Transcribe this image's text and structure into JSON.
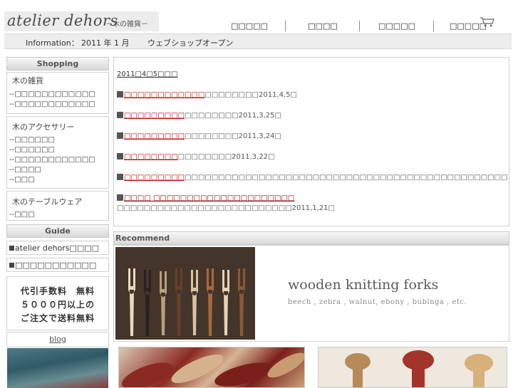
{
  "header": {
    "logo": "atelier dehors",
    "logo_sub": "－木の雑貨－",
    "nav": [
      "□□□□□",
      "□□□□",
      "□□□□□",
      "□□□□□"
    ]
  },
  "info": {
    "label": "Information：",
    "date": "2011 年 1 月",
    "message": "ウェブショップオープン"
  },
  "sidebar": {
    "shopping_heading": "Shopping",
    "boxes": [
      {
        "title": "木の雑貨",
        "links": [
          "--□□□□□□□□□□□□",
          "--□□□□□□□□□□□□"
        ]
      },
      {
        "title": "木のアクセサリー",
        "links": [
          "--□□□□□□",
          "--□□□□□□",
          "--□□□□□□□□□□□□",
          "--□□□□",
          "--□□□"
        ]
      },
      {
        "title": "木のテーブルウェア",
        "links": [
          "--□□□"
        ]
      }
    ],
    "guide_heading": "Guide",
    "guide_links": [
      "atelier dehors□□□□",
      "□□□□□□□□□□□"
    ],
    "fee_lines": [
      "代引手数料　無料",
      "５０００円以上の",
      "ご注文で送料無料"
    ],
    "blog": "blog"
  },
  "news": {
    "date_link": "2011□4□5□□□",
    "items": [
      {
        "link": "□□□□□□□□□□□□",
        "text": "□□□□□□□□2011,4,5□",
        "line2": ""
      },
      {
        "link": "□□□□□□□□□",
        "text": "□□□□□□□□2011,3,25□",
        "line2": ""
      },
      {
        "link": "□□□□□□□□□",
        "text": "□□□□□□□□2011,3,24□",
        "line2": ""
      },
      {
        "link": "□□□□□□□□",
        "text": "□□□□□□□□2011,3,22□",
        "line2": ""
      },
      {
        "link": "□□□□□□□□□",
        "text": "□□□□□□□□□□□□□□□□□□□□□□□□□□□□□□□□□□□□□□□□□□□□□□□□□□□□□□□□□□□□□□□□□□□□□□□",
        "line2": ""
      },
      {
        "link": "□□□□ □□□□□□□□□□□□□□□□□□□□□",
        "text": "",
        "line2": "□□□□□□□□□□□□□□□□□□□□□□□□□□2011,1,21□"
      }
    ]
  },
  "recommend": {
    "heading": "Recommend",
    "title": "wooden knitting forks",
    "subtitle": "beech , zebra , walnut, ebony , bubinga , etc."
  },
  "icons": {
    "cart": "cart-icon"
  },
  "colors": {
    "link_red": "#c00000",
    "text": "#444444",
    "header_bg": "#ececec"
  }
}
